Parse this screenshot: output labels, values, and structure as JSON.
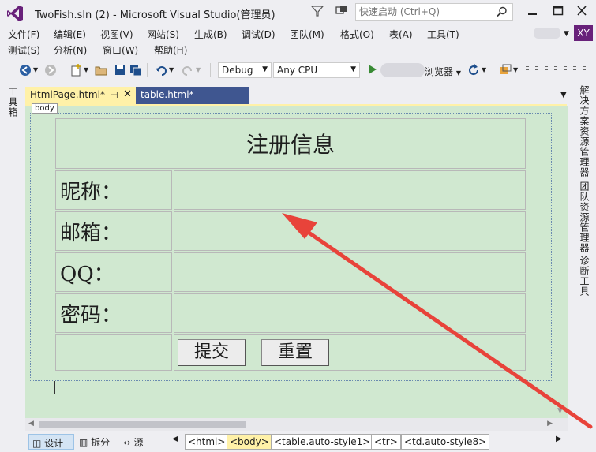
{
  "window": {
    "title": "TwoFish.sln (2) - Microsoft Visual Studio(管理员)",
    "quick_launch_placeholder": "快速启动 (Ctrl+Q)",
    "avatar_initials": "XY"
  },
  "menu": {
    "row1": [
      "文件(F)",
      "编辑(E)",
      "视图(V)",
      "网站(S)",
      "生成(B)",
      "调试(D)",
      "团队(M)",
      "格式(O)",
      "表(A)",
      "工具(T)"
    ],
    "row2": [
      "测试(S)",
      "分析(N)",
      "窗口(W)",
      "帮助(H)"
    ]
  },
  "toolbar": {
    "config": "Debug",
    "platform": "Any CPU",
    "browser_label": "浏览器"
  },
  "side_panels": {
    "left": "工具箱",
    "right": [
      "解决方案资源管理器",
      "团队资源管理器",
      "诊断工具"
    ]
  },
  "tabs": [
    {
      "label": "HtmlPage.html*",
      "active": true
    },
    {
      "label": "table.html*",
      "active": false
    }
  ],
  "designer": {
    "body_tag": "body",
    "form": {
      "title": "注册信息",
      "fields": [
        "昵称：",
        "邮箱：",
        "QQ：",
        "密码："
      ],
      "submit_label": "提交",
      "reset_label": "重置"
    }
  },
  "bottom": {
    "views": [
      "设计",
      "拆分",
      "源"
    ],
    "breadcrumb": [
      "<html>",
      "<body>",
      "<table.auto-style1>",
      "<tr>",
      "<td.auto-style8>"
    ]
  },
  "colors": {
    "designer_bg": "#d0e8d0",
    "active_tab": "#fff1a8",
    "inactive_tab": "#3f5690",
    "annotation_arrow": "#e8433a",
    "vs_purple": "#68217a"
  }
}
